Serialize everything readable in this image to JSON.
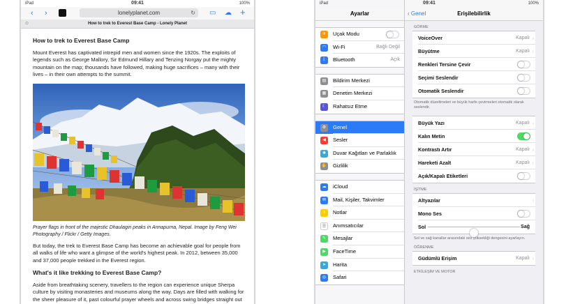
{
  "left": {
    "status": {
      "device": "iPad",
      "time": "09:41",
      "battery": "100%"
    },
    "url": "lonelyplanet.com",
    "tab_title": "How to trek to Everest Base Camp - Lonely Planet",
    "article": {
      "heading1": "How to trek to Everest Base Camp",
      "para1": "Mount Everest has captivated intrepid men and women since the 1920s. The exploits of legends such as George Mallory, Sir Edmund Hillary and Tenzing Norgay put the mighty mountain on the map; thousands have followed, making huge sacrifices – many with their lives – in their own attempts to the summit.",
      "caption": "Prayer flags in front of the majestic Dhaulagiri peaks in Annapurna, Nepal. Image by Feng Wei Photography / Flickr / Getty Images.",
      "para2": "But today, the trek to Everest Base Camp has become an achievable goal for people from all walks of life who want a glimpse of the world's highest peak. In 2012, between 35,000 and 37,000 people trekked in the Everest region.",
      "heading2": "What's it like trekking to Everest Base Camp?",
      "para3": "Aside from breathtaking scenery, travellers to the region can experience unique Sherpa culture by visiting monasteries and museums along the way. Days are filled with walking for the sheer pleasure of it, past colourful prayer wheels and across swing bridges straight out of"
    }
  },
  "right": {
    "status": {
      "device": "iPad",
      "time": "09:41",
      "battery": "100%"
    },
    "master_title": "Ayarlar",
    "master_sections": [
      [
        {
          "label": "Uçak Modu",
          "icon": "airplane-icon",
          "color": "#ff9500",
          "toggle": false
        },
        {
          "label": "Wi-Fi",
          "icon": "wifi-icon",
          "color": "#2a7bf5",
          "value": "Bağlı Değil"
        },
        {
          "label": "Bluetooth",
          "icon": "bluetooth-icon",
          "color": "#2a7bf5",
          "value": "Açık"
        }
      ],
      [
        {
          "label": "Bildirim Merkezi",
          "icon": "notification-icon",
          "color": "#8e8e93"
        },
        {
          "label": "Denetim Merkezi",
          "icon": "control-center-icon",
          "color": "#8e8e93"
        },
        {
          "label": "Rahatsız Etme",
          "icon": "moon-icon",
          "color": "#5856d6"
        }
      ],
      [
        {
          "label": "Genel",
          "icon": "gear-icon",
          "color": "#8e8e93",
          "selected": true
        },
        {
          "label": "Sesler",
          "icon": "speaker-icon",
          "color": "#ff3b30"
        },
        {
          "label": "Duvar Kağıtları ve Parlaklık",
          "icon": "wallpaper-icon",
          "color": "#34aadc"
        },
        {
          "label": "Gizlilik",
          "icon": "hand-icon",
          "color": "#8e8e93"
        }
      ],
      [
        {
          "label": "iCloud",
          "icon": "cloud-icon",
          "color": "#2a7bf5"
        },
        {
          "label": "Mail, Kişiler, Takvimler",
          "icon": "mail-icon",
          "color": "#2a7bf5"
        },
        {
          "label": "Notlar",
          "icon": "notes-icon",
          "color": "#ffcc00"
        },
        {
          "label": "Anımsatıcılar",
          "icon": "reminders-icon",
          "color": "#ffffff"
        },
        {
          "label": "Mesajlar",
          "icon": "messages-icon",
          "color": "#4cd964"
        },
        {
          "label": "FaceTime",
          "icon": "facetime-icon",
          "color": "#4cd964"
        },
        {
          "label": "Harita",
          "icon": "map-icon",
          "color": "#34aadc"
        },
        {
          "label": "Safari",
          "icon": "safari-icon",
          "color": "#2a7bf5"
        }
      ]
    ],
    "detail": {
      "back_label": "Genel",
      "title": "Erişilebilirlik",
      "sections": [
        {
          "header": "GÖRME",
          "rows": [
            {
              "label": "VoiceOver",
              "value": "Kapalı"
            },
            {
              "label": "Büyütme",
              "value": "Kapalı"
            },
            {
              "label": "Renkleri Tersine Çevir",
              "toggle": false
            },
            {
              "label": "Seçimi Seslendir",
              "toggle": false
            },
            {
              "label": "Otomatik Seslendir",
              "toggle": false
            }
          ],
          "footer": "Otomatik düzeltmeleri ve büyük harfe çevirmeleri otomatik olarak seslendir."
        },
        {
          "header": "",
          "rows": [
            {
              "label": "Büyük Yazı",
              "value": "Kapalı"
            },
            {
              "label": "Kalın Metin",
              "toggle": true
            },
            {
              "label": "Kontrastı Artır",
              "value": "Kapalı"
            },
            {
              "label": "Hareketi Azalt",
              "value": "Kapalı"
            },
            {
              "label": "Açık/Kapalı Etiketleri",
              "toggle": false
            }
          ],
          "footer": ""
        },
        {
          "header": "İŞİTME",
          "rows": [
            {
              "label": "Altyazılar",
              "value": ""
            },
            {
              "label": "Mono Ses",
              "toggle": false
            },
            {
              "label": "Sol",
              "slider": true,
              "right_label": "Sağ",
              "level": 0.5
            }
          ],
          "footer": "Sol ve sağ kanallar arasındaki ses yüksekliği dengesini ayarlayın."
        },
        {
          "header": "ÖĞRENME",
          "rows": [
            {
              "label": "Güdümlü Erişim",
              "value": "Kapalı"
            }
          ],
          "footer": ""
        },
        {
          "header": "ETKİLEŞİM VE MOTOR",
          "rows": [],
          "footer": ""
        }
      ]
    }
  }
}
